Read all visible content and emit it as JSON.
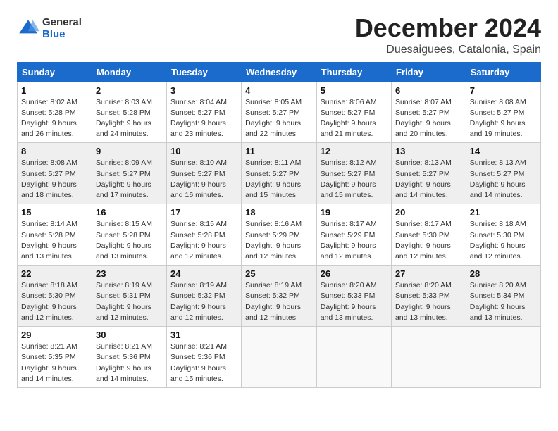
{
  "header": {
    "logo_general": "General",
    "logo_blue": "Blue",
    "month": "December 2024",
    "location": "Duesaiguees, Catalonia, Spain"
  },
  "weekdays": [
    "Sunday",
    "Monday",
    "Tuesday",
    "Wednesday",
    "Thursday",
    "Friday",
    "Saturday"
  ],
  "weeks": [
    [
      {
        "day": "1",
        "sunrise": "8:02 AM",
        "sunset": "5:28 PM",
        "daylight": "9 hours and 26 minutes."
      },
      {
        "day": "2",
        "sunrise": "8:03 AM",
        "sunset": "5:28 PM",
        "daylight": "9 hours and 24 minutes."
      },
      {
        "day": "3",
        "sunrise": "8:04 AM",
        "sunset": "5:27 PM",
        "daylight": "9 hours and 23 minutes."
      },
      {
        "day": "4",
        "sunrise": "8:05 AM",
        "sunset": "5:27 PM",
        "daylight": "9 hours and 22 minutes."
      },
      {
        "day": "5",
        "sunrise": "8:06 AM",
        "sunset": "5:27 PM",
        "daylight": "9 hours and 21 minutes."
      },
      {
        "day": "6",
        "sunrise": "8:07 AM",
        "sunset": "5:27 PM",
        "daylight": "9 hours and 20 minutes."
      },
      {
        "day": "7",
        "sunrise": "8:08 AM",
        "sunset": "5:27 PM",
        "daylight": "9 hours and 19 minutes."
      }
    ],
    [
      {
        "day": "8",
        "sunrise": "8:08 AM",
        "sunset": "5:27 PM",
        "daylight": "9 hours and 18 minutes."
      },
      {
        "day": "9",
        "sunrise": "8:09 AM",
        "sunset": "5:27 PM",
        "daylight": "9 hours and 17 minutes."
      },
      {
        "day": "10",
        "sunrise": "8:10 AM",
        "sunset": "5:27 PM",
        "daylight": "9 hours and 16 minutes."
      },
      {
        "day": "11",
        "sunrise": "8:11 AM",
        "sunset": "5:27 PM",
        "daylight": "9 hours and 15 minutes."
      },
      {
        "day": "12",
        "sunrise": "8:12 AM",
        "sunset": "5:27 PM",
        "daylight": "9 hours and 15 minutes."
      },
      {
        "day": "13",
        "sunrise": "8:13 AM",
        "sunset": "5:27 PM",
        "daylight": "9 hours and 14 minutes."
      },
      {
        "day": "14",
        "sunrise": "8:13 AM",
        "sunset": "5:27 PM",
        "daylight": "9 hours and 14 minutes."
      }
    ],
    [
      {
        "day": "15",
        "sunrise": "8:14 AM",
        "sunset": "5:28 PM",
        "daylight": "9 hours and 13 minutes."
      },
      {
        "day": "16",
        "sunrise": "8:15 AM",
        "sunset": "5:28 PM",
        "daylight": "9 hours and 13 minutes."
      },
      {
        "day": "17",
        "sunrise": "8:15 AM",
        "sunset": "5:28 PM",
        "daylight": "9 hours and 12 minutes."
      },
      {
        "day": "18",
        "sunrise": "8:16 AM",
        "sunset": "5:29 PM",
        "daylight": "9 hours and 12 minutes."
      },
      {
        "day": "19",
        "sunrise": "8:17 AM",
        "sunset": "5:29 PM",
        "daylight": "9 hours and 12 minutes."
      },
      {
        "day": "20",
        "sunrise": "8:17 AM",
        "sunset": "5:30 PM",
        "daylight": "9 hours and 12 minutes."
      },
      {
        "day": "21",
        "sunrise": "8:18 AM",
        "sunset": "5:30 PM",
        "daylight": "9 hours and 12 minutes."
      }
    ],
    [
      {
        "day": "22",
        "sunrise": "8:18 AM",
        "sunset": "5:30 PM",
        "daylight": "9 hours and 12 minutes."
      },
      {
        "day": "23",
        "sunrise": "8:19 AM",
        "sunset": "5:31 PM",
        "daylight": "9 hours and 12 minutes."
      },
      {
        "day": "24",
        "sunrise": "8:19 AM",
        "sunset": "5:32 PM",
        "daylight": "9 hours and 12 minutes."
      },
      {
        "day": "25",
        "sunrise": "8:19 AM",
        "sunset": "5:32 PM",
        "daylight": "9 hours and 12 minutes."
      },
      {
        "day": "26",
        "sunrise": "8:20 AM",
        "sunset": "5:33 PM",
        "daylight": "9 hours and 13 minutes."
      },
      {
        "day": "27",
        "sunrise": "8:20 AM",
        "sunset": "5:33 PM",
        "daylight": "9 hours and 13 minutes."
      },
      {
        "day": "28",
        "sunrise": "8:20 AM",
        "sunset": "5:34 PM",
        "daylight": "9 hours and 13 minutes."
      }
    ],
    [
      {
        "day": "29",
        "sunrise": "8:21 AM",
        "sunset": "5:35 PM",
        "daylight": "9 hours and 14 minutes."
      },
      {
        "day": "30",
        "sunrise": "8:21 AM",
        "sunset": "5:36 PM",
        "daylight": "9 hours and 14 minutes."
      },
      {
        "day": "31",
        "sunrise": "8:21 AM",
        "sunset": "5:36 PM",
        "daylight": "9 hours and 15 minutes."
      },
      null,
      null,
      null,
      null
    ]
  ]
}
